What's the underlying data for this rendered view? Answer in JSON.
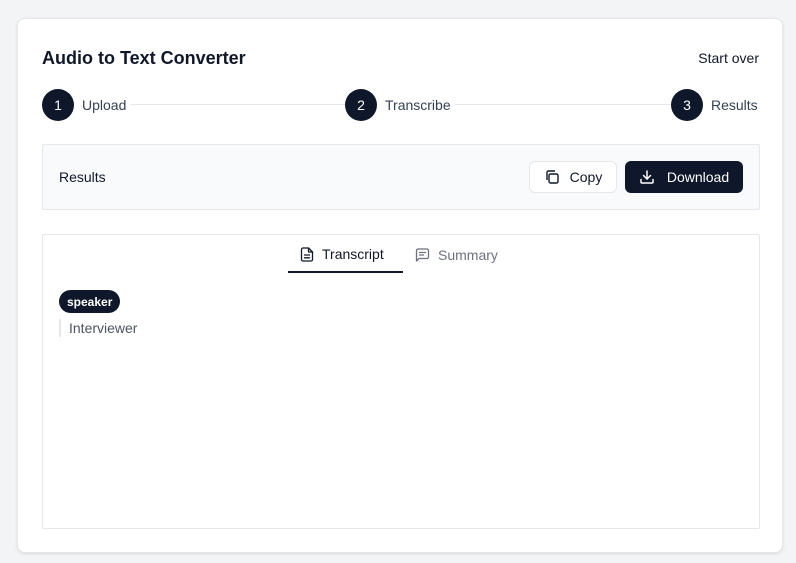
{
  "app": {
    "title": "Audio to Text Converter",
    "start_over_label": "Start over"
  },
  "stepper": {
    "steps": [
      {
        "number": "1",
        "label": "Upload"
      },
      {
        "number": "2",
        "label": "Transcribe"
      },
      {
        "number": "3",
        "label": "Results"
      }
    ]
  },
  "results_bar": {
    "label": "Results",
    "copy_label": "Copy",
    "download_label": "Download"
  },
  "tabs": [
    {
      "label": "Transcript",
      "icon": "file-text-icon",
      "active": true
    },
    {
      "label": "Summary",
      "icon": "message-square-icon",
      "active": false
    }
  ],
  "transcript": {
    "speaker_badge": "speaker",
    "line": "Interviewer"
  },
  "colors": {
    "primary": "#0f172a",
    "border": "#e5e7eb",
    "muted_text": "#6b7280",
    "panel_bg": "#f8fafc"
  }
}
